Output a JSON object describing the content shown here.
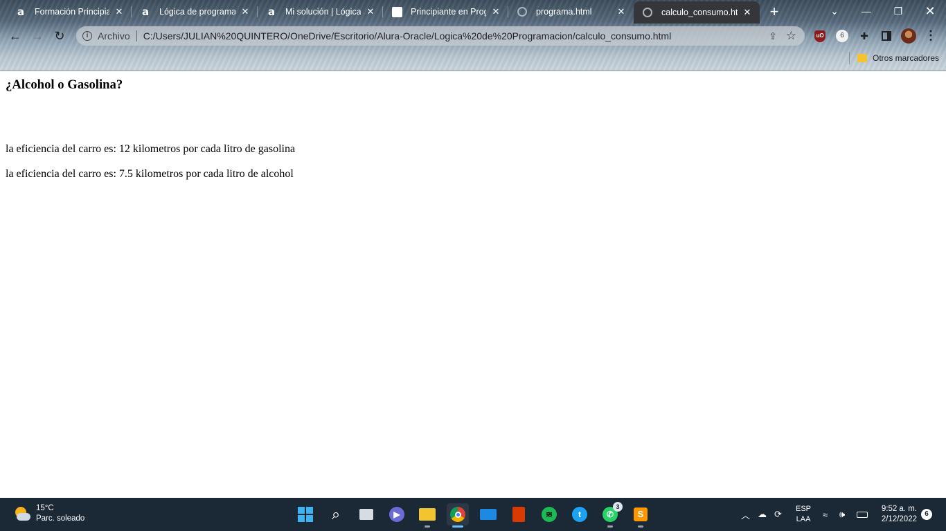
{
  "browser": {
    "tabs": [
      {
        "title": "Formación Principiante",
        "favicon": "alura-icon"
      },
      {
        "title": "Lógica de programación",
        "favicon": "alura-icon"
      },
      {
        "title": "Mi solución | Lógica de",
        "favicon": "alura-icon"
      },
      {
        "title": "Principiante en Progra",
        "favicon": "document-icon"
      },
      {
        "title": "programa.html",
        "favicon": "globe-icon"
      },
      {
        "title": "calculo_consumo.html",
        "favicon": "globe-icon",
        "active": true
      }
    ],
    "new_tab": "+",
    "address": {
      "scheme_label": "Archivo",
      "url": "C:/Users/JULIAN%20QUINTERO/OneDrive/Escritorio/Alura-Oracle/Logica%20de%20Programacion/calculo_consumo.html"
    },
    "extensions": {
      "six": "6"
    },
    "bookmarks": {
      "other_label": "Otros marcadores"
    }
  },
  "page": {
    "heading": "¿Alcohol o Gasolina?",
    "lines": [
      "la eficiencia del carro es: 12 kilometros por cada litro de gasolina",
      "la eficiencia del carro es: 7.5 kilometros por cada litro de alcohol"
    ]
  },
  "taskbar": {
    "weather": {
      "temp": "15°C",
      "condition": "Parc. soleado"
    },
    "whatsapp_badge": "3",
    "language": {
      "line1": "ESP",
      "line2": "LAA"
    },
    "clock": {
      "time": "9:52 a. m.",
      "date": "2/12/2022"
    },
    "notifications": "6"
  }
}
